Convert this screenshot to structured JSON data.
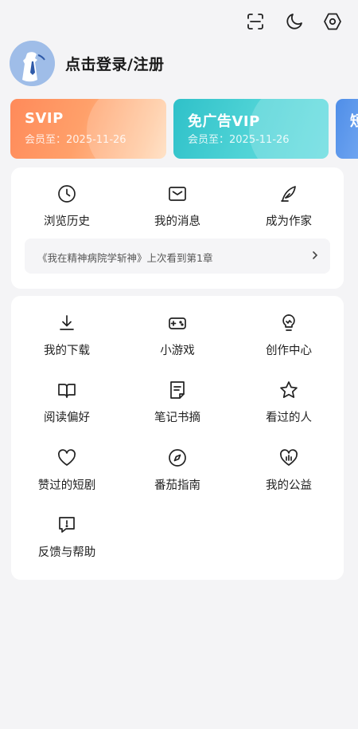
{
  "header": {
    "login_text": "点击登录/注册",
    "icons": [
      "scan-icon",
      "night-mode-icon",
      "settings-icon"
    ]
  },
  "vip_cards": [
    {
      "title": "SVIP",
      "expiry": "会员至：2025-11-26",
      "color": "#ff8a5a"
    },
    {
      "title": "免广告VIP",
      "expiry": "会员至：2025-11-26",
      "color": "#2fc1c9"
    },
    {
      "title": "短",
      "expiry": "",
      "color": "#4f8ee8"
    }
  ],
  "quick": [
    {
      "label": "浏览历史",
      "icon": "clock-icon"
    },
    {
      "label": "我的消息",
      "icon": "mail-icon"
    },
    {
      "label": "成为作家",
      "icon": "quill-icon"
    }
  ],
  "history": {
    "text": "《我在精神病院学斩神》上次看到第1章"
  },
  "services": [
    {
      "label": "我的下载",
      "icon": "download-icon"
    },
    {
      "label": "小游戏",
      "icon": "gamepad-icon"
    },
    {
      "label": "创作中心",
      "icon": "bulb-icon"
    },
    {
      "label": "阅读偏好",
      "icon": "book-icon"
    },
    {
      "label": "笔记书摘",
      "icon": "note-icon"
    },
    {
      "label": "看过的人",
      "icon": "star-icon"
    },
    {
      "label": "赞过的短剧",
      "icon": "heart-icon"
    },
    {
      "label": "番茄指南",
      "icon": "compass-icon"
    },
    {
      "label": "我的公益",
      "icon": "charity-icon"
    },
    {
      "label": "反馈与帮助",
      "icon": "feedback-icon"
    }
  ]
}
